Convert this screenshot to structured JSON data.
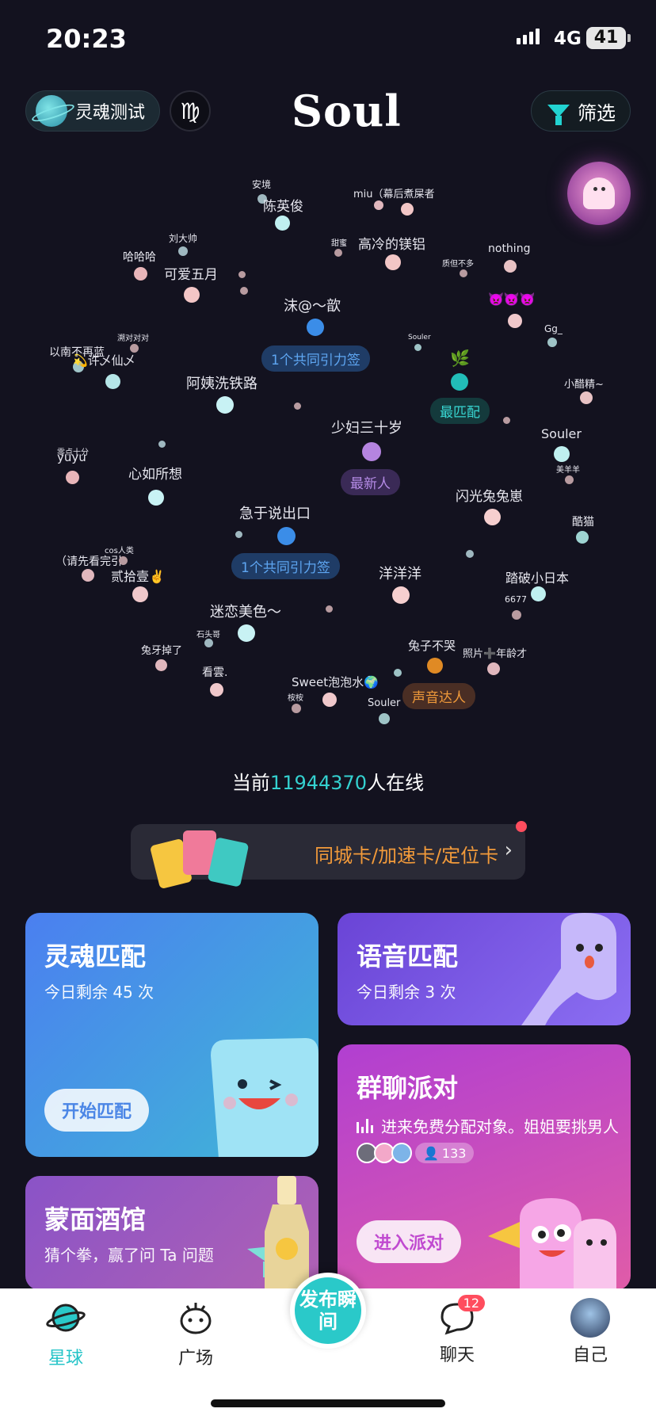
{
  "status_bar": {
    "time": "20:23",
    "network": "4G",
    "battery": "41"
  },
  "header": {
    "soul_test_label": "灵魂测试",
    "zodiac_symbol": "♍",
    "logo": "Soul",
    "filter_label": "筛选"
  },
  "star_map": {
    "users": [
      {
        "name": "安境",
        "color": "#b5e6e6"
      },
      {
        "name": "陈英俊",
        "color": "#bfeff0"
      },
      {
        "name": "miu（幕后煮屎者",
        "color": "#e0b7bd"
      },
      {
        "name": "高冷的镁铝",
        "color": "#f2c6c6"
      },
      {
        "name": "刘大帅",
        "color": "#9fb8c0"
      },
      {
        "name": "哈哈哈",
        "color": "#e8b5b9"
      },
      {
        "name": "可爱五月",
        "color": "#f3c6c6"
      },
      {
        "name": "甜蜜",
        "color": "#b89ba0"
      },
      {
        "name": "质但不多",
        "color": "#b89ba0"
      },
      {
        "name": "nothing",
        "color": "#e8c2c4"
      },
      {
        "name": "沫@～歆",
        "color": "#3b8de8"
      },
      {
        "name": "👿👿👿",
        "color": "#f0c8cb"
      },
      {
        "name": "Gg_",
        "color": "#9ec3c6"
      },
      {
        "name": "以南不再蓝",
        "color": "#a0c5c8"
      },
      {
        "name": "溯对对对",
        "color": "#b89ba0"
      },
      {
        "name": "💫许乄仙乄",
        "color": "#b5e6e8"
      },
      {
        "name": "Souler",
        "color": "#b0b0b0"
      },
      {
        "name": "🌿",
        "color": "#22bdb8"
      },
      {
        "name": "阿姨洗铁路",
        "color": "#c8f2f4"
      },
      {
        "name": "小醋精~",
        "color": "#e8c2c4"
      },
      {
        "name": "少妇三十岁",
        "color": "#b584e0"
      },
      {
        "name": "Souler",
        "color": "#bff0f0"
      },
      {
        "name": "yuyu",
        "color": "#e8b5b9"
      },
      {
        "name": "零点十分",
        "color": "#b89ba0"
      },
      {
        "name": "心如所想",
        "color": "#c8f2f4"
      },
      {
        "name": "美羊羊",
        "color": "#b89ba0"
      },
      {
        "name": "闪光兔兔崽",
        "color": "#f6cfcf"
      },
      {
        "name": "急于说出口",
        "color": "#3b8de8"
      },
      {
        "name": "酷猫",
        "color": "#9ed4d2"
      },
      {
        "name": "cos人类",
        "color": "#b89ba0"
      },
      {
        "name": "（请先看完引",
        "color": "#e0b7bd"
      },
      {
        "name": "贰拾壹✌️",
        "color": "#f0c8cb"
      },
      {
        "name": "洋洋洋",
        "color": "#f6cfcf"
      },
      {
        "name": "踏破小日本",
        "color": "#bff0f0"
      },
      {
        "name": "6677",
        "color": "#b89ba0"
      },
      {
        "name": "迷恋美色～",
        "color": "#c8f2f4"
      },
      {
        "name": "石头哥",
        "color": "#9fb8c0"
      },
      {
        "name": "兔牙掉了",
        "color": "#e0b7bd"
      },
      {
        "name": "兔子不哭",
        "color": "#e08a24"
      },
      {
        "name": "照片➕年龄才",
        "color": "#e0b7bd"
      },
      {
        "name": "看雲.",
        "color": "#f0c8cb"
      },
      {
        "name": "Sweet泡泡水🌍",
        "color": "#f0c8cb"
      },
      {
        "name": "桉桉",
        "color": "#b89ba0"
      },
      {
        "name": "Souler",
        "color": "#9ec3c6"
      }
    ],
    "tags": {
      "common_tag_1": "1个共同引力签",
      "common_tag_2": "1个共同引力签",
      "best_match": "最匹配",
      "newest": "最新人",
      "voice_expert": "声音达人"
    }
  },
  "online": {
    "prefix": "当前",
    "count": "11944370",
    "suffix": "人在线"
  },
  "banner": {
    "text": "同城卡/加速卡/定位卡"
  },
  "cards": {
    "soul_match": {
      "title": "灵魂匹配",
      "subtitle": "今日剩余 45 次",
      "button": "开始匹配"
    },
    "voice_match": {
      "title": "语音匹配",
      "subtitle": "今日剩余 3 次"
    },
    "group_party": {
      "title": "群聊派对",
      "message": "进来免费分配对象。姐姐要挑男人",
      "count": "133",
      "button": "进入派对"
    },
    "masked_bar": {
      "title": "蒙面酒馆",
      "subtitle": "猜个拳，赢了问 Ta 问题"
    }
  },
  "tabbar": {
    "planet": "星球",
    "square": "广场",
    "publish": "发布瞬间",
    "chat": "聊天",
    "chat_badge": "12",
    "me": "自己"
  },
  "colors": {
    "accent": "#25c4c8",
    "background": "#13121f",
    "orange": "#f29a3a"
  }
}
